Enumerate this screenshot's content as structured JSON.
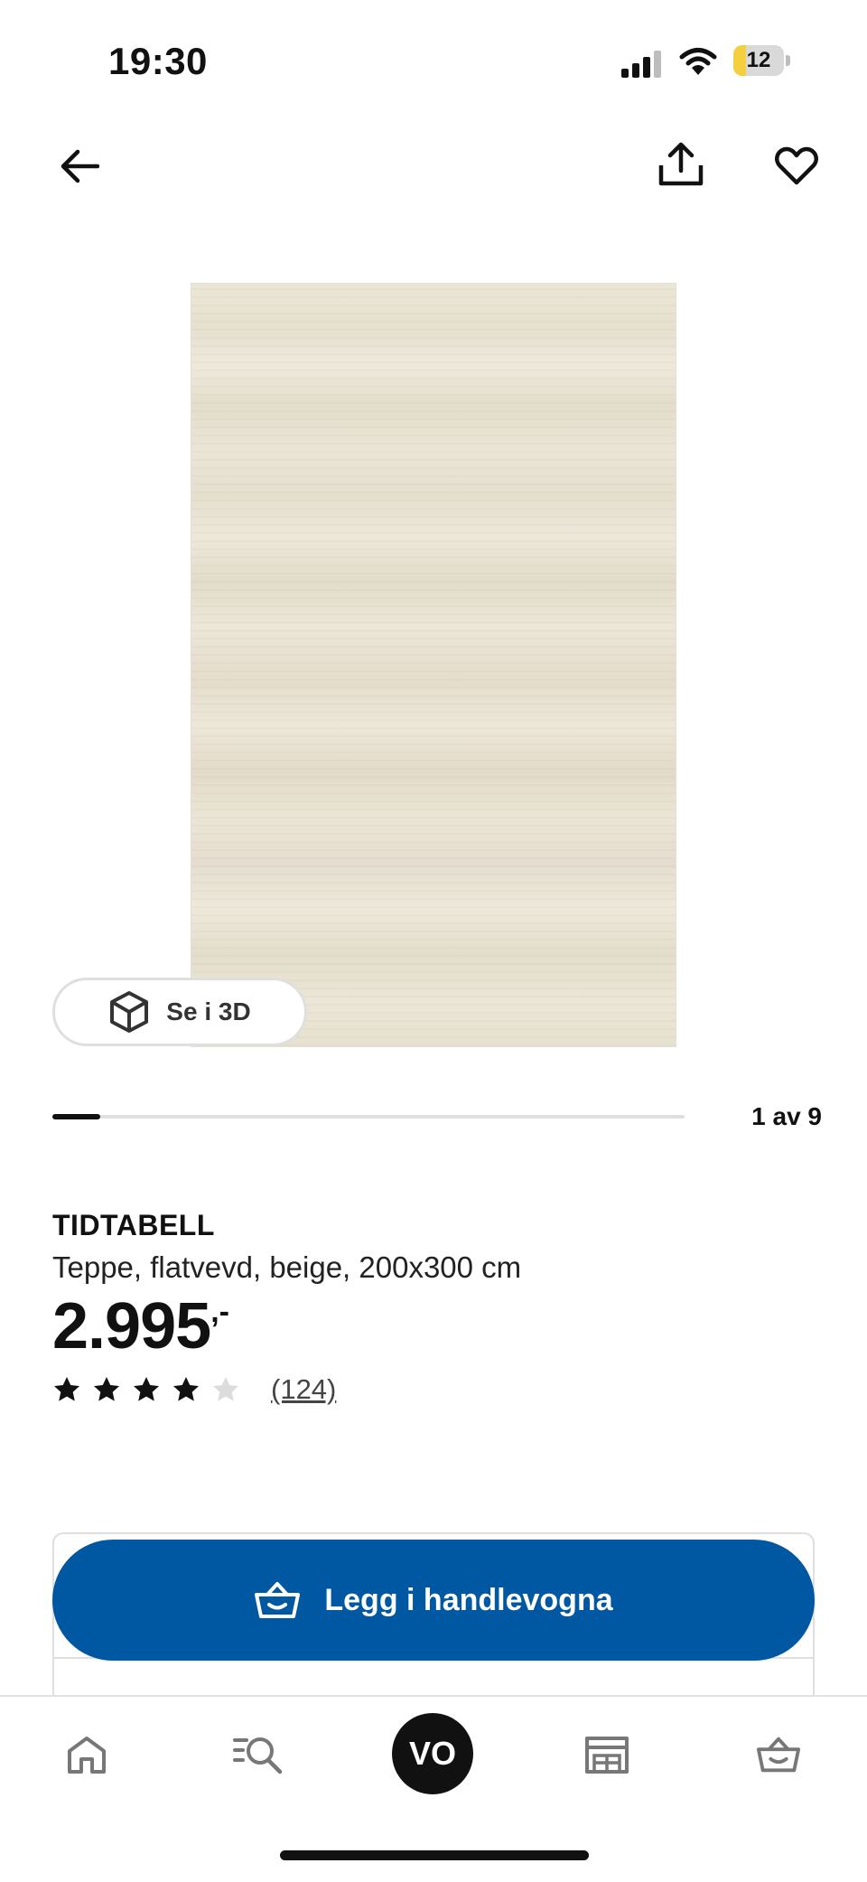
{
  "status_bar": {
    "time": "19:30",
    "battery": "12",
    "icons": [
      "signal-icon",
      "wifi-icon",
      "battery-icon"
    ]
  },
  "header": {
    "icons": [
      "back-arrow-icon",
      "share-icon",
      "heart-icon"
    ]
  },
  "gallery": {
    "view_3d_label": "Se i 3D",
    "counter": "1 av 9",
    "current_index": 1,
    "total_images": 9
  },
  "product": {
    "name": "TIDTABELL",
    "description": "Teppe, flatvevd, beige, 200x300 cm",
    "price": "2.995",
    "price_suffix": ",-",
    "rating": 4,
    "rating_max": 5,
    "review_count": "(124)"
  },
  "actions": {
    "add_to_cart_label": "Legg i handlevogna"
  },
  "bottom_nav": {
    "profile_initials": "VO",
    "items": [
      "home-icon",
      "search-icon",
      "profile-avatar",
      "store-icon",
      "cart-icon"
    ]
  },
  "colors": {
    "primary_blue": "#0058a3",
    "text": "#111111",
    "border": "#dfdfdf",
    "battery_fill": "#f4d03f"
  }
}
